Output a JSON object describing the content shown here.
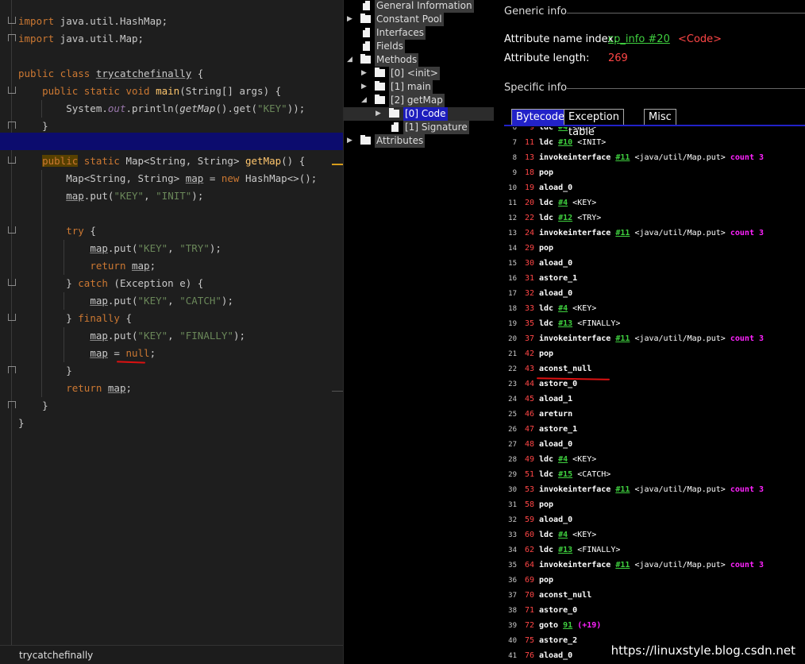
{
  "editor": {
    "filename": "trycatchefinally",
    "lines": [
      {
        "html": "<span class='k'>import</span> java.util.HashMap;"
      },
      {
        "html": "<span class='k'>import</span> java.util.Map;"
      },
      {
        "html": ""
      },
      {
        "html": "<span class='k'>public class</span> <span class='u'>trycatchefinally</span> {"
      },
      {
        "html": "    <span class='k'>public static void</span> <span class='m'>main</span>(String[] args) {"
      },
      {
        "html": "        System.<span class='f'>out</span>.println(<span class='i'>getMap</span>().get(<span class='s'>\"KEY\"</span>));"
      },
      {
        "html": "    }"
      },
      {
        "html": ""
      },
      {
        "html": "    <span class='kbg'>public</span> <span class='k'>static</span> Map&lt;String, String&gt; <span class='m'>getMap</span>() {"
      },
      {
        "html": "        Map&lt;String, String&gt; <span class='u'>map</span> = <span class='k'>new</span> HashMap&lt;&gt;();"
      },
      {
        "html": "        <span class='u'>map</span>.put(<span class='s'>\"KEY\"</span>, <span class='s'>\"INIT\"</span>);"
      },
      {
        "html": ""
      },
      {
        "html": "        <span class='k'>try</span> {"
      },
      {
        "html": "            <span class='u'>map</span>.put(<span class='s'>\"KEY\"</span>, <span class='s'>\"TRY\"</span>);"
      },
      {
        "html": "            <span class='k'>return</span> <span class='u'>map</span>;"
      },
      {
        "html": "        } <span class='k'>catch</span> (Exception e) {"
      },
      {
        "html": "            <span class='u'>map</span>.put(<span class='s'>\"KEY\"</span>, <span class='s'>\"CATCH\"</span>);"
      },
      {
        "html": "        } <span class='k'>finally</span> {"
      },
      {
        "html": "            <span class='u'>map</span>.put(<span class='s'>\"KEY\"</span>, <span class='s'>\"FINALLY\"</span>);"
      },
      {
        "html": "            <span class='u'>map</span> = <span class='k'>null</span>;"
      },
      {
        "html": "        }"
      },
      {
        "html": "        <span class='k'>return</span> <span class='u'>map</span>;"
      },
      {
        "html": "    }"
      },
      {
        "html": "}"
      }
    ]
  },
  "tree": {
    "items": [
      {
        "label": "General Information",
        "icon": "file"
      },
      {
        "label": "Constant Pool",
        "icon": "folder"
      },
      {
        "label": "Interfaces",
        "icon": "file"
      },
      {
        "label": "Fields",
        "icon": "file"
      },
      {
        "label": "Methods",
        "icon": "folder",
        "expanded": true
      },
      {
        "label": "[0] <init>",
        "icon": "folder"
      },
      {
        "label": "[1] main",
        "icon": "folder"
      },
      {
        "label": "[2] getMap",
        "icon": "folder",
        "expanded": true
      },
      {
        "label": "[0] Code",
        "icon": "folder",
        "selected": true
      },
      {
        "label": "[1] Signature",
        "icon": "file"
      },
      {
        "label": "Attributes",
        "icon": "folder"
      }
    ]
  },
  "panel": {
    "generic_info_title": "Generic info",
    "attr_name_index_label": "Attribute name index:",
    "attr_name_index_link": "cp_info #20",
    "attr_name_index_value": "<Code>",
    "attr_length_label": "Attribute length:",
    "attr_length_value": "269",
    "specific_info_title": "Specific info",
    "tabs": [
      "Bytecode",
      "Exception table",
      "Misc"
    ],
    "active_tab": "Bytecode",
    "bytecode": [
      {
        "ln": "6",
        "off": "9",
        "op": "ldc",
        "ref": "#4",
        "cmt": "<KEY>"
      },
      {
        "ln": "7",
        "off": "11",
        "op": "ldc",
        "ref": "#10",
        "cmt": "<INIT>"
      },
      {
        "ln": "8",
        "off": "13",
        "op": "invokeinterface",
        "ref": "#11",
        "cmt": "<java/util/Map.put>",
        "cnt": "count 3"
      },
      {
        "ln": "9",
        "off": "18",
        "op": "pop"
      },
      {
        "ln": "10",
        "off": "19",
        "op": "aload_0"
      },
      {
        "ln": "11",
        "off": "20",
        "op": "ldc",
        "ref": "#4",
        "cmt": "<KEY>"
      },
      {
        "ln": "12",
        "off": "22",
        "op": "ldc",
        "ref": "#12",
        "cmt": "<TRY>"
      },
      {
        "ln": "13",
        "off": "24",
        "op": "invokeinterface",
        "ref": "#11",
        "cmt": "<java/util/Map.put>",
        "cnt": "count 3"
      },
      {
        "ln": "14",
        "off": "29",
        "op": "pop"
      },
      {
        "ln": "15",
        "off": "30",
        "op": "aload_0"
      },
      {
        "ln": "16",
        "off": "31",
        "op": "astore_1"
      },
      {
        "ln": "17",
        "off": "32",
        "op": "aload_0"
      },
      {
        "ln": "18",
        "off": "33",
        "op": "ldc",
        "ref": "#4",
        "cmt": "<KEY>"
      },
      {
        "ln": "19",
        "off": "35",
        "op": "ldc",
        "ref": "#13",
        "cmt": "<FINALLY>"
      },
      {
        "ln": "20",
        "off": "37",
        "op": "invokeinterface",
        "ref": "#11",
        "cmt": "<java/util/Map.put>",
        "cnt": "count 3"
      },
      {
        "ln": "21",
        "off": "42",
        "op": "pop"
      },
      {
        "ln": "22",
        "off": "43",
        "op": "aconst_null"
      },
      {
        "ln": "23",
        "off": "44",
        "op": "astore_0"
      },
      {
        "ln": "24",
        "off": "45",
        "op": "aload_1"
      },
      {
        "ln": "25",
        "off": "46",
        "op": "areturn"
      },
      {
        "ln": "26",
        "off": "47",
        "op": "astore_1"
      },
      {
        "ln": "27",
        "off": "48",
        "op": "aload_0"
      },
      {
        "ln": "28",
        "off": "49",
        "op": "ldc",
        "ref": "#4",
        "cmt": "<KEY>"
      },
      {
        "ln": "29",
        "off": "51",
        "op": "ldc",
        "ref": "#15",
        "cmt": "<CATCH>"
      },
      {
        "ln": "30",
        "off": "53",
        "op": "invokeinterface",
        "ref": "#11",
        "cmt": "<java/util/Map.put>",
        "cnt": "count 3"
      },
      {
        "ln": "31",
        "off": "58",
        "op": "pop"
      },
      {
        "ln": "32",
        "off": "59",
        "op": "aload_0"
      },
      {
        "ln": "33",
        "off": "60",
        "op": "ldc",
        "ref": "#4",
        "cmt": "<KEY>"
      },
      {
        "ln": "34",
        "off": "62",
        "op": "ldc",
        "ref": "#13",
        "cmt": "<FINALLY>"
      },
      {
        "ln": "35",
        "off": "64",
        "op": "invokeinterface",
        "ref": "#11",
        "cmt": "<java/util/Map.put>",
        "cnt": "count 3"
      },
      {
        "ln": "36",
        "off": "69",
        "op": "pop"
      },
      {
        "ln": "37",
        "off": "70",
        "op": "aconst_null"
      },
      {
        "ln": "38",
        "off": "71",
        "op": "astore_0"
      },
      {
        "ln": "39",
        "off": "72",
        "op": "goto",
        "ref": "91",
        "cnt": "(+19)"
      },
      {
        "ln": "40",
        "off": "75",
        "op": "astore_2"
      },
      {
        "ln": "41",
        "off": "76",
        "op": "aload_0"
      }
    ]
  },
  "watermark": "https://linuxstyle.blog.csdn.net"
}
